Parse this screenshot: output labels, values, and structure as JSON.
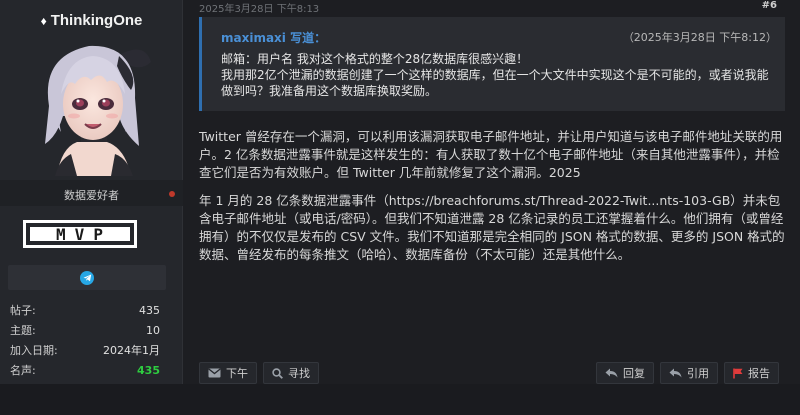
{
  "user": {
    "name": "ThinkingOne",
    "role": "数据爱好者",
    "badge": "MVP",
    "stats": [
      {
        "label": "帖子:",
        "value": "435"
      },
      {
        "label": "主题:",
        "value": "10"
      },
      {
        "label": "加入日期:",
        "value": "2024年1月"
      },
      {
        "label": "名声:",
        "value": "435"
      }
    ],
    "colors": {
      "reputation": "#2ecc40",
      "telegram": "#27a7e5",
      "status": "#c0392b"
    }
  },
  "post": {
    "date": "2025年3月28日 下午8:13",
    "number": "#6",
    "quote": {
      "author": "maximaxi 写道：",
      "time": "（2025年3月28日 下午8:12）",
      "line1": "邮箱：用户名 我对这个格式的整个28亿数据库很感兴趣！",
      "line2": "我用那2亿个泄漏的数据创建了一个这样的数据库，但在一个大文件中实现这个是不可能的，或者说我能做到吗？我准备用这个数据库换取奖励。"
    },
    "paragraph1": "Twitter 曾经存在一个漏洞，可以利用该漏洞获取电子邮件地址，并让用户知道与该电子邮件地址关联的用户。2 亿条数据泄露事件就是这样发生的：有人获取了数十亿个电子邮件地址（来自其他泄露事件），并检查它们是否为有效账户。但 Twitter 几年前就修复了这个漏洞。2025",
    "paragraph2": "年 1 月的 28 亿条数据泄露事件（https://breachforums.st/Thread-2022-Twit...nts-103-GB）并未包含电子邮件地址（或电话/密码）。但我们不知道泄露 28 亿条记录的员工还掌握着什么。他们拥有（或曾经拥有）的不仅仅是发布的 CSV 文件。我们不知道那是完全相同的 JSON 格式的数据、更多的 JSON 格式的数据、曾经发布的每条推文（哈哈）、数据库备份（不太可能）还是其他什么。"
  },
  "actions": {
    "left": [
      {
        "label": "下午",
        "icon": "mail-icon"
      },
      {
        "label": "寻找",
        "icon": "search-icon"
      }
    ],
    "right": [
      {
        "label": "回复",
        "icon": "reply-icon"
      },
      {
        "label": "引用",
        "icon": "quote-icon"
      },
      {
        "label": "报告",
        "icon": "flag-icon"
      }
    ]
  }
}
